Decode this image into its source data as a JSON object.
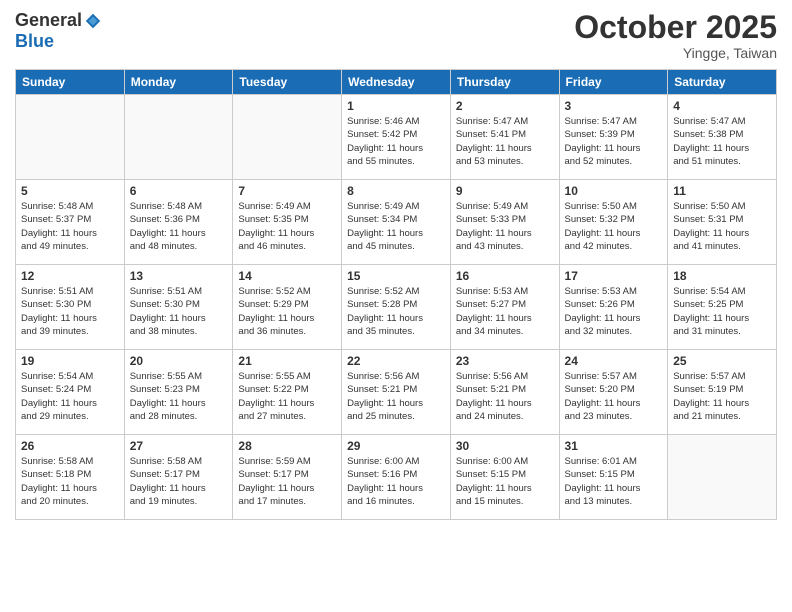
{
  "logo": {
    "general": "General",
    "blue": "Blue"
  },
  "title": "October 2025",
  "location": "Yingge, Taiwan",
  "headers": [
    "Sunday",
    "Monday",
    "Tuesday",
    "Wednesday",
    "Thursday",
    "Friday",
    "Saturday"
  ],
  "weeks": [
    [
      {
        "day": "",
        "info": ""
      },
      {
        "day": "",
        "info": ""
      },
      {
        "day": "",
        "info": ""
      },
      {
        "day": "1",
        "info": "Sunrise: 5:46 AM\nSunset: 5:42 PM\nDaylight: 11 hours\nand 55 minutes."
      },
      {
        "day": "2",
        "info": "Sunrise: 5:47 AM\nSunset: 5:41 PM\nDaylight: 11 hours\nand 53 minutes."
      },
      {
        "day": "3",
        "info": "Sunrise: 5:47 AM\nSunset: 5:39 PM\nDaylight: 11 hours\nand 52 minutes."
      },
      {
        "day": "4",
        "info": "Sunrise: 5:47 AM\nSunset: 5:38 PM\nDaylight: 11 hours\nand 51 minutes."
      }
    ],
    [
      {
        "day": "5",
        "info": "Sunrise: 5:48 AM\nSunset: 5:37 PM\nDaylight: 11 hours\nand 49 minutes."
      },
      {
        "day": "6",
        "info": "Sunrise: 5:48 AM\nSunset: 5:36 PM\nDaylight: 11 hours\nand 48 minutes."
      },
      {
        "day": "7",
        "info": "Sunrise: 5:49 AM\nSunset: 5:35 PM\nDaylight: 11 hours\nand 46 minutes."
      },
      {
        "day": "8",
        "info": "Sunrise: 5:49 AM\nSunset: 5:34 PM\nDaylight: 11 hours\nand 45 minutes."
      },
      {
        "day": "9",
        "info": "Sunrise: 5:49 AM\nSunset: 5:33 PM\nDaylight: 11 hours\nand 43 minutes."
      },
      {
        "day": "10",
        "info": "Sunrise: 5:50 AM\nSunset: 5:32 PM\nDaylight: 11 hours\nand 42 minutes."
      },
      {
        "day": "11",
        "info": "Sunrise: 5:50 AM\nSunset: 5:31 PM\nDaylight: 11 hours\nand 41 minutes."
      }
    ],
    [
      {
        "day": "12",
        "info": "Sunrise: 5:51 AM\nSunset: 5:30 PM\nDaylight: 11 hours\nand 39 minutes."
      },
      {
        "day": "13",
        "info": "Sunrise: 5:51 AM\nSunset: 5:30 PM\nDaylight: 11 hours\nand 38 minutes."
      },
      {
        "day": "14",
        "info": "Sunrise: 5:52 AM\nSunset: 5:29 PM\nDaylight: 11 hours\nand 36 minutes."
      },
      {
        "day": "15",
        "info": "Sunrise: 5:52 AM\nSunset: 5:28 PM\nDaylight: 11 hours\nand 35 minutes."
      },
      {
        "day": "16",
        "info": "Sunrise: 5:53 AM\nSunset: 5:27 PM\nDaylight: 11 hours\nand 34 minutes."
      },
      {
        "day": "17",
        "info": "Sunrise: 5:53 AM\nSunset: 5:26 PM\nDaylight: 11 hours\nand 32 minutes."
      },
      {
        "day": "18",
        "info": "Sunrise: 5:54 AM\nSunset: 5:25 PM\nDaylight: 11 hours\nand 31 minutes."
      }
    ],
    [
      {
        "day": "19",
        "info": "Sunrise: 5:54 AM\nSunset: 5:24 PM\nDaylight: 11 hours\nand 29 minutes."
      },
      {
        "day": "20",
        "info": "Sunrise: 5:55 AM\nSunset: 5:23 PM\nDaylight: 11 hours\nand 28 minutes."
      },
      {
        "day": "21",
        "info": "Sunrise: 5:55 AM\nSunset: 5:22 PM\nDaylight: 11 hours\nand 27 minutes."
      },
      {
        "day": "22",
        "info": "Sunrise: 5:56 AM\nSunset: 5:21 PM\nDaylight: 11 hours\nand 25 minutes."
      },
      {
        "day": "23",
        "info": "Sunrise: 5:56 AM\nSunset: 5:21 PM\nDaylight: 11 hours\nand 24 minutes."
      },
      {
        "day": "24",
        "info": "Sunrise: 5:57 AM\nSunset: 5:20 PM\nDaylight: 11 hours\nand 23 minutes."
      },
      {
        "day": "25",
        "info": "Sunrise: 5:57 AM\nSunset: 5:19 PM\nDaylight: 11 hours\nand 21 minutes."
      }
    ],
    [
      {
        "day": "26",
        "info": "Sunrise: 5:58 AM\nSunset: 5:18 PM\nDaylight: 11 hours\nand 20 minutes."
      },
      {
        "day": "27",
        "info": "Sunrise: 5:58 AM\nSunset: 5:17 PM\nDaylight: 11 hours\nand 19 minutes."
      },
      {
        "day": "28",
        "info": "Sunrise: 5:59 AM\nSunset: 5:17 PM\nDaylight: 11 hours\nand 17 minutes."
      },
      {
        "day": "29",
        "info": "Sunrise: 6:00 AM\nSunset: 5:16 PM\nDaylight: 11 hours\nand 16 minutes."
      },
      {
        "day": "30",
        "info": "Sunrise: 6:00 AM\nSunset: 5:15 PM\nDaylight: 11 hours\nand 15 minutes."
      },
      {
        "day": "31",
        "info": "Sunrise: 6:01 AM\nSunset: 5:15 PM\nDaylight: 11 hours\nand 13 minutes."
      },
      {
        "day": "",
        "info": ""
      }
    ]
  ]
}
